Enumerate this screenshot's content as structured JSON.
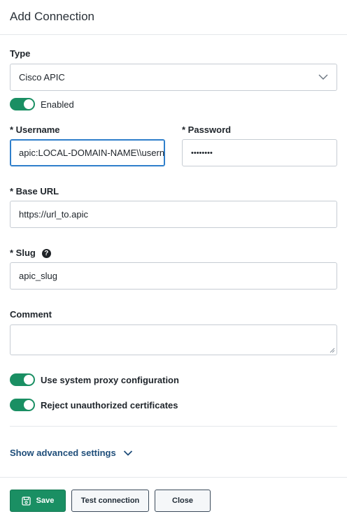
{
  "dialog": {
    "title": "Add Connection"
  },
  "form": {
    "type_label": "Type",
    "type_value": "Cisco APIC",
    "enabled_label": "Enabled",
    "username_label": "* Username",
    "username_value": "apic:LOCAL-DOMAIN-NAME\\\\username",
    "password_label": "* Password",
    "password_value": "••••••••",
    "base_url_label": "* Base URL",
    "base_url_value": "https://url_to.apic",
    "slug_label": "* Slug",
    "slug_value": "apic_slug",
    "comment_label": "Comment",
    "comment_value": "",
    "proxy_label": "Use system proxy configuration",
    "reject_label": "Reject unauthorized certificates",
    "advanced_label": "Show advanced settings",
    "toggles": {
      "enabled": true,
      "proxy": true,
      "reject": true
    }
  },
  "footer": {
    "save_label": "Save",
    "test_label": "Test connection",
    "close_label": "Close"
  },
  "colors": {
    "accent": "#1a8f63",
    "focus": "#2f7fcb",
    "link": "#1f4e7a"
  },
  "icons": {
    "select": "chevron-down-icon",
    "help": "help-icon",
    "save": "save-icon",
    "advanced": "chevron-down-icon"
  }
}
